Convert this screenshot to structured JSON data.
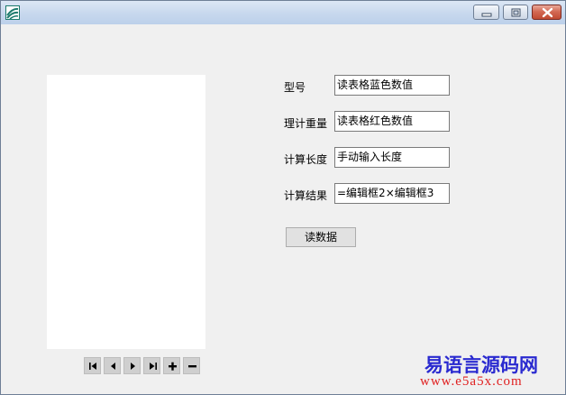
{
  "window": {
    "title": "",
    "icon": "app-logo-icon",
    "controls": [
      "minimize-icon",
      "maximize-icon",
      "close-icon"
    ]
  },
  "form": {
    "rows": [
      {
        "label": "型号",
        "value": "读表格蓝色数值"
      },
      {
        "label": "理计重量",
        "value": "读表格红色数值"
      },
      {
        "label": "计算长度",
        "value": "手动输入长度"
      },
      {
        "label": "计算结果",
        "value": "=编辑框2×编辑框3"
      }
    ],
    "read_button": "读数据"
  },
  "navigator": {
    "buttons": [
      "first-record-icon",
      "prior-record-icon",
      "next-record-icon",
      "last-record-icon",
      "insert-record-icon",
      "delete-record-icon"
    ]
  },
  "watermark": {
    "name": "易语言源码网",
    "url": "www.e5a5x.com"
  }
}
